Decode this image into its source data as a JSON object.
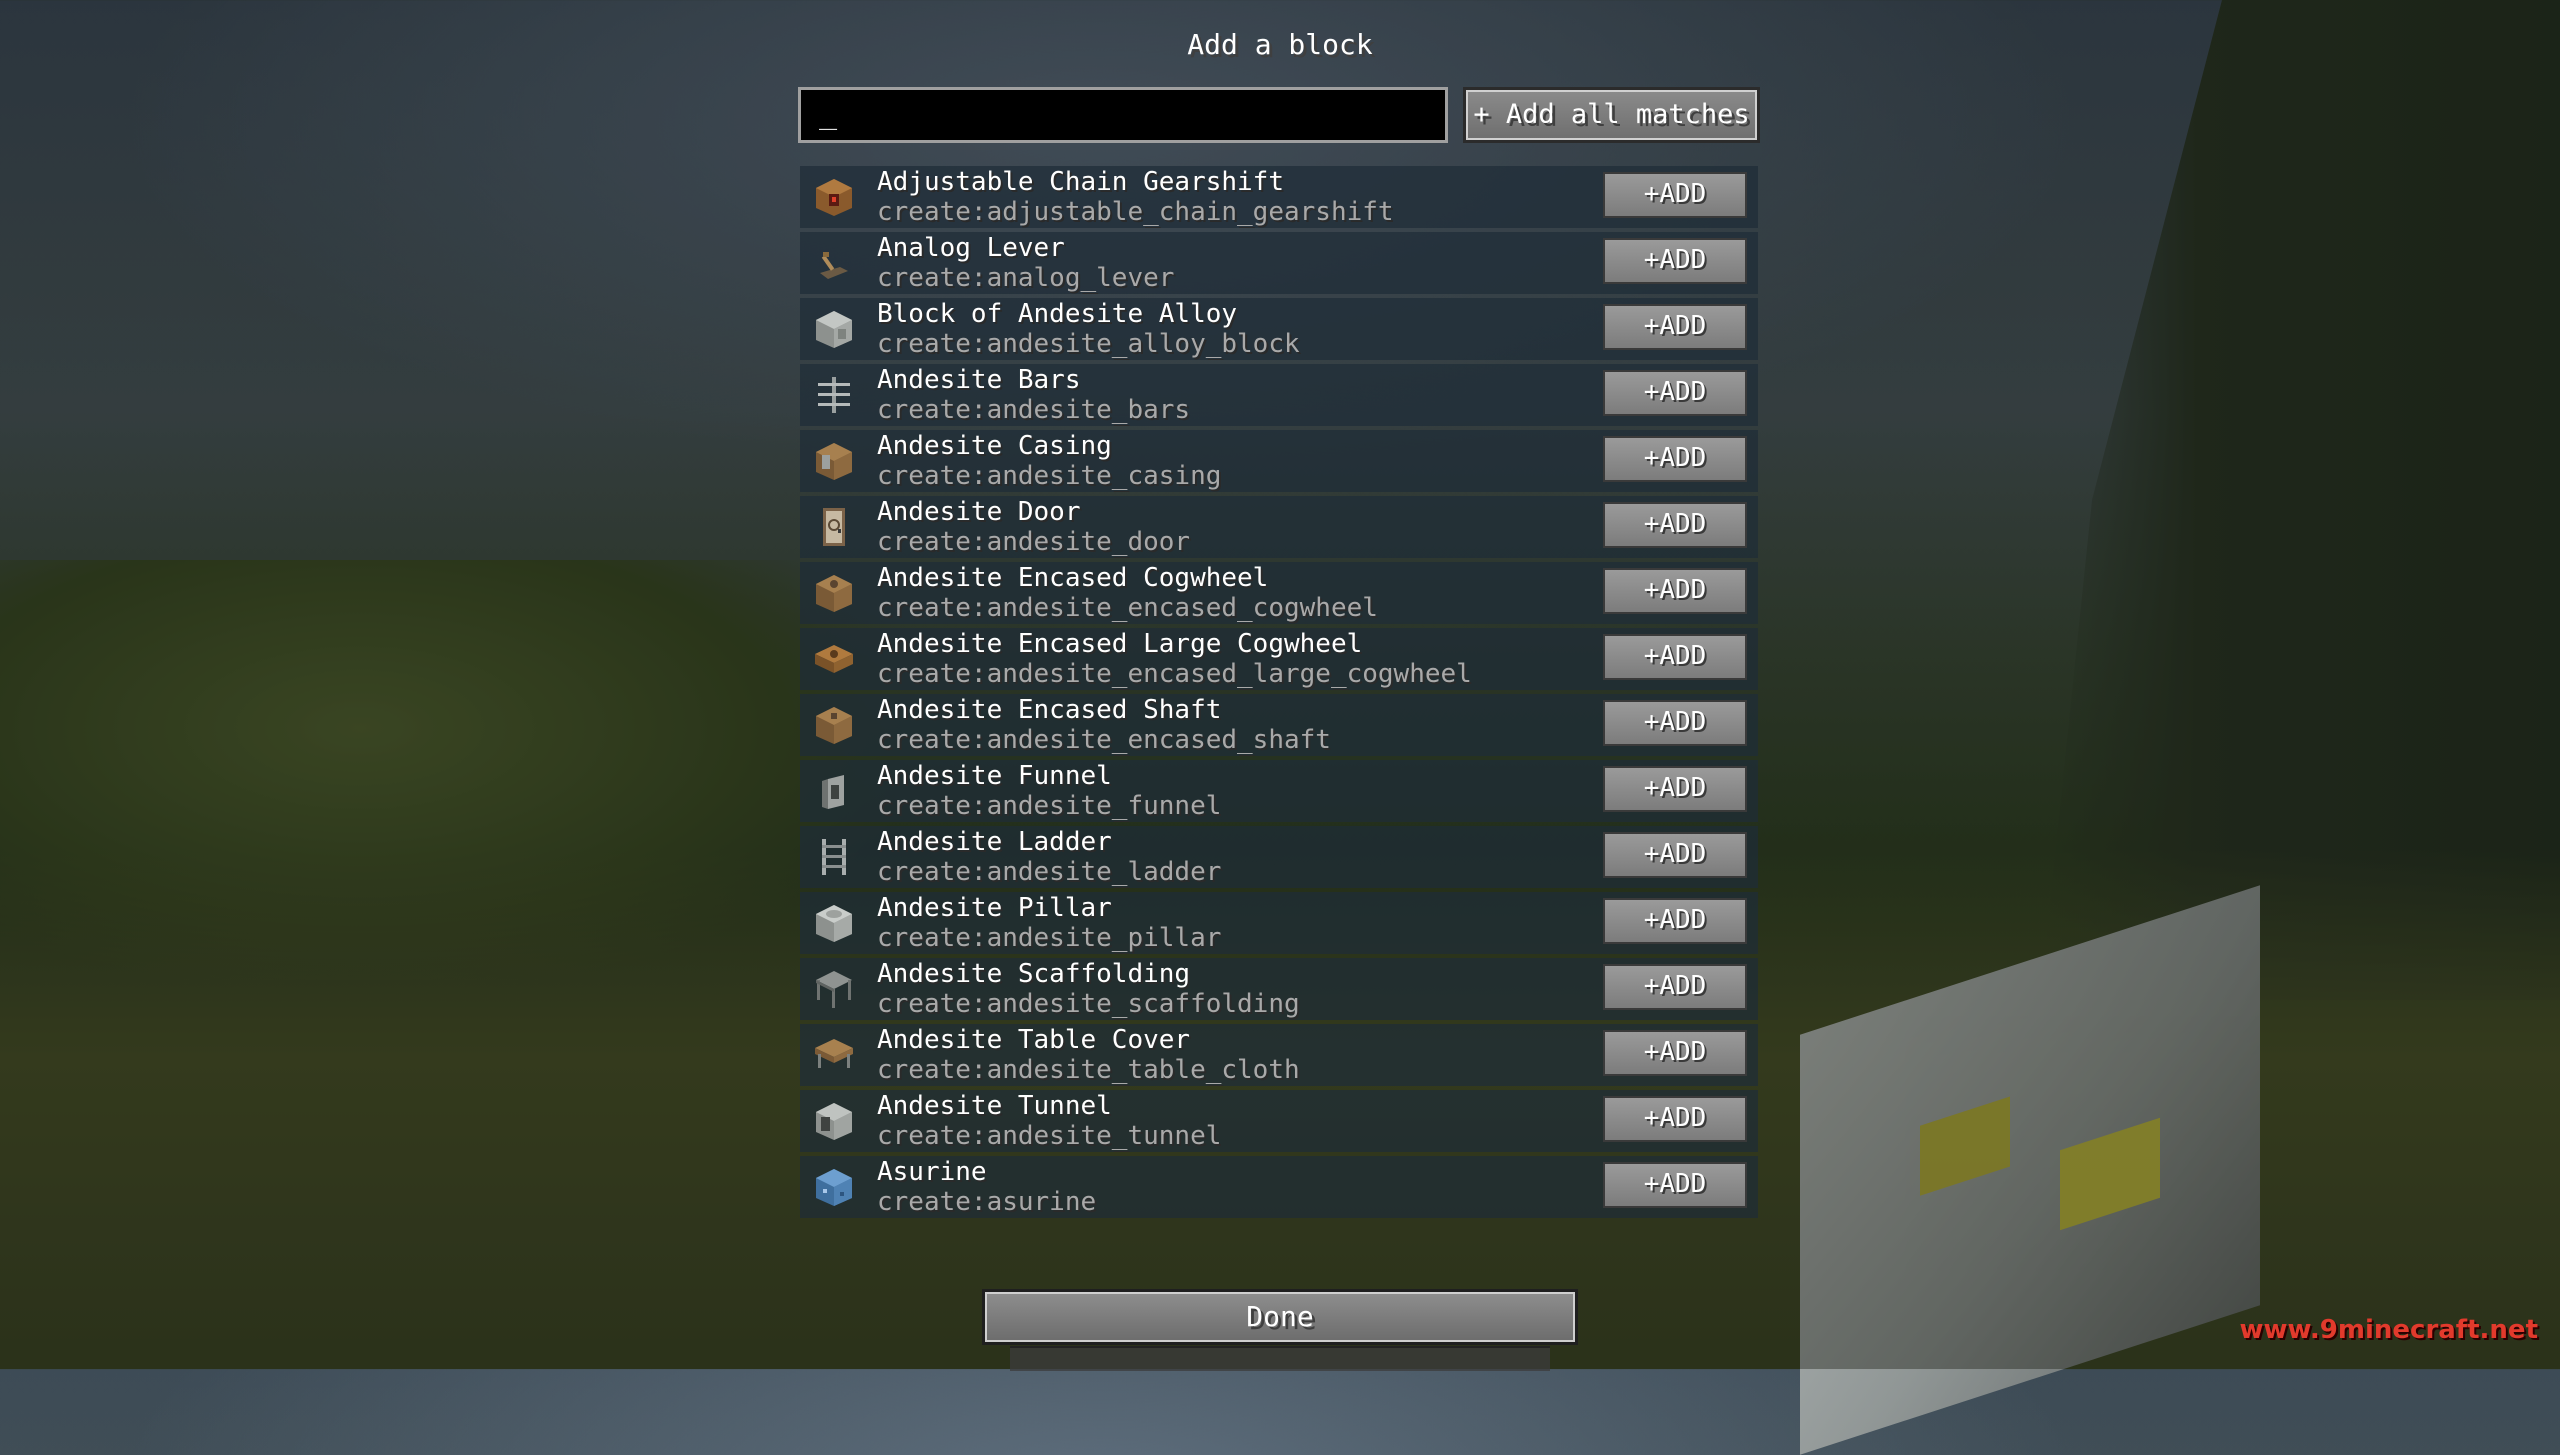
{
  "screen": {
    "title": "Add a block"
  },
  "search": {
    "value": "_"
  },
  "add_all_label": "+ Add all matches",
  "blocks": [
    {
      "name": "Adjustable Chain Gearshift",
      "id": "create:adjustable_chain_gearshift",
      "add_label": "+ADD",
      "icon": "gearshift-icon"
    },
    {
      "name": "Analog Lever",
      "id": "create:analog_lever",
      "add_label": "+ADD",
      "icon": "lever-icon"
    },
    {
      "name": "Block of Andesite Alloy",
      "id": "create:andesite_alloy_block",
      "add_label": "+ADD",
      "icon": "alloy-block-icon"
    },
    {
      "name": "Andesite Bars",
      "id": "create:andesite_bars",
      "add_label": "+ADD",
      "icon": "bars-icon"
    },
    {
      "name": "Andesite Casing",
      "id": "create:andesite_casing",
      "add_label": "+ADD",
      "icon": "casing-icon"
    },
    {
      "name": "Andesite Door",
      "id": "create:andesite_door",
      "add_label": "+ADD",
      "icon": "door-icon"
    },
    {
      "name": "Andesite Encased Cogwheel",
      "id": "create:andesite_encased_cogwheel",
      "add_label": "+ADD",
      "icon": "encased-cogwheel-icon"
    },
    {
      "name": "Andesite Encased Large Cogwheel",
      "id": "create:andesite_encased_large_cogwheel",
      "add_label": "+ADD",
      "icon": "large-cogwheel-icon"
    },
    {
      "name": "Andesite Encased Shaft",
      "id": "create:andesite_encased_shaft",
      "add_label": "+ADD",
      "icon": "encased-shaft-icon"
    },
    {
      "name": "Andesite Funnel",
      "id": "create:andesite_funnel",
      "add_label": "+ADD",
      "icon": "funnel-icon"
    },
    {
      "name": "Andesite Ladder",
      "id": "create:andesite_ladder",
      "add_label": "+ADD",
      "icon": "ladder-icon"
    },
    {
      "name": "Andesite Pillar",
      "id": "create:andesite_pillar",
      "add_label": "+ADD",
      "icon": "pillar-icon"
    },
    {
      "name": "Andesite Scaffolding",
      "id": "create:andesite_scaffolding",
      "add_label": "+ADD",
      "icon": "scaffolding-icon"
    },
    {
      "name": "Andesite Table Cover",
      "id": "create:andesite_table_cloth",
      "add_label": "+ADD",
      "icon": "table-cover-icon"
    },
    {
      "name": "Andesite Tunnel",
      "id": "create:andesite_tunnel",
      "add_label": "+ADD",
      "icon": "tunnel-icon"
    },
    {
      "name": "Asurine",
      "id": "create:asurine",
      "add_label": "+ADD",
      "icon": "asurine-icon"
    }
  ],
  "done_label": "Done",
  "watermark": "www.9minecraft.net"
}
